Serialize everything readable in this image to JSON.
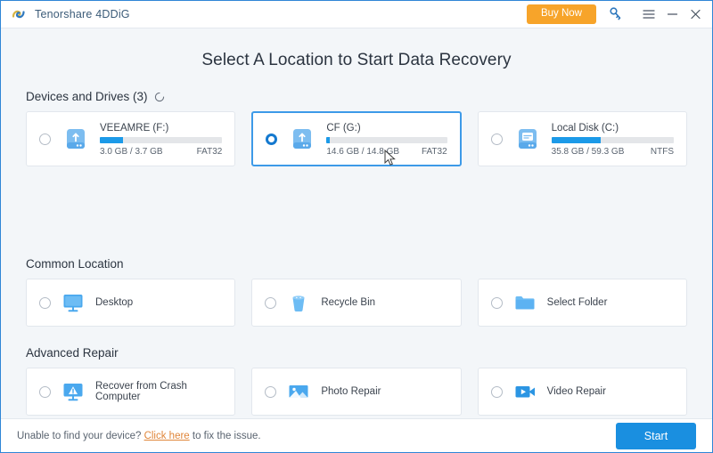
{
  "titlebar": {
    "app_name": "Tenorshare 4DDiG",
    "logo_icon": "tenorshare-logo-icon",
    "buy_now_label": "Buy Now",
    "key_icon": "key-icon",
    "menu_icon": "hamburger-menu-icon",
    "minimize_icon": "minimize-icon",
    "close_icon": "close-icon",
    "accent_orange": "#f7a42a"
  },
  "main": {
    "page_title": "Select A Location to Start Data Recovery",
    "devices_section": {
      "heading": "Devices and Drives (3)",
      "refresh_icon": "refresh-icon",
      "drives": [
        {
          "name": "VEEAMRE (F:)",
          "used": "3.0 GB",
          "total": "3.7 GB",
          "usage_text": "3.0 GB / 3.7 GB",
          "filesystem": "FAT32",
          "fill_percent": 19,
          "icon": "usb-drive-icon",
          "selected": false
        },
        {
          "name": "CF (G:)",
          "used": "14.6 GB",
          "total": "14.8 GB",
          "usage_text": "14.6 GB / 14.8 GB",
          "filesystem": "FAT32",
          "fill_percent": 2,
          "icon": "usb-drive-icon",
          "selected": true
        },
        {
          "name": "Local Disk (C:)",
          "used": "35.8 GB",
          "total": "59.3 GB",
          "usage_text": "35.8 GB / 59.3 GB",
          "filesystem": "NTFS",
          "fill_percent": 40,
          "icon": "hard-disk-icon",
          "selected": false
        }
      ]
    },
    "common_location_section": {
      "heading": "Common Location",
      "items": [
        {
          "label": "Desktop",
          "icon": "monitor-icon"
        },
        {
          "label": "Recycle Bin",
          "icon": "recycle-bin-icon"
        },
        {
          "label": "Select Folder",
          "icon": "folder-icon"
        }
      ]
    },
    "advanced_repair_section": {
      "heading": "Advanced Repair",
      "items": [
        {
          "label": "Recover from Crash Computer",
          "icon": "crash-computer-icon"
        },
        {
          "label": "Photo Repair",
          "icon": "photo-icon"
        },
        {
          "label": "Video Repair",
          "icon": "video-camera-icon"
        }
      ]
    }
  },
  "footer": {
    "note_prefix": "Unable to find your device? ",
    "link_label": "Click here",
    "note_suffix": " to fix the issue.",
    "start_label": "Start",
    "accent_blue": "#1a8fe0",
    "link_color": "#e0863a"
  }
}
